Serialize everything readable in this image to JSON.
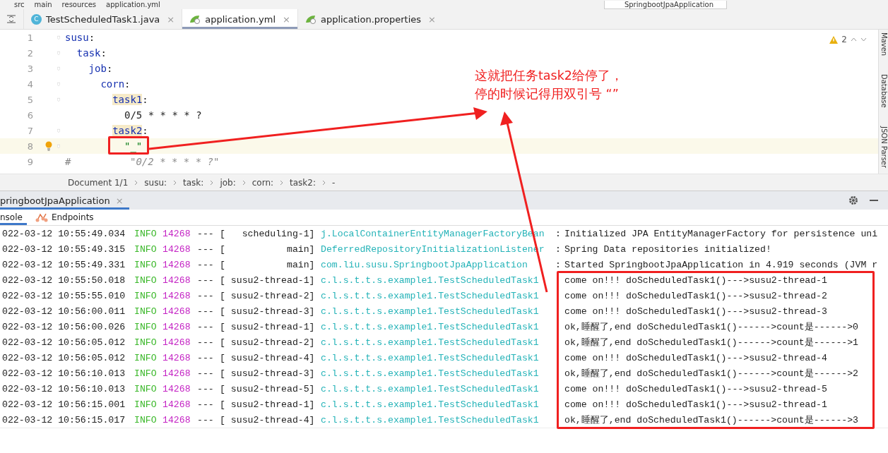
{
  "path_bar": {
    "items": [
      "src",
      "main",
      "resources",
      "application.yml"
    ],
    "run_config": "SpringbootJpaApplication"
  },
  "tabs": [
    {
      "label": "TestScheduledTask1.java",
      "kind": "class",
      "icon": "C",
      "close": "×",
      "selected": false
    },
    {
      "label": "application.yml",
      "kind": "spring",
      "close": "×",
      "selected": true
    },
    {
      "label": "application.properties",
      "kind": "spring",
      "close": "×",
      "selected": false
    }
  ],
  "editor": {
    "warnings": "2",
    "lines": [
      {
        "number": "1",
        "key": "susu",
        "colon": ":",
        "children": [
          {
            "number": "2",
            "key": "task",
            "colon": ":",
            "children": [
              {
                "number": "3",
                "key": "job",
                "colon": ":",
                "children": [
                  {
                    "number": "4",
                    "key": "corn",
                    "colon": ":",
                    "children": [
                      {
                        "number": "5",
                        "key": "task1",
                        "colon": ":",
                        "highlighted": true,
                        "children": [
                          {
                            "number": "6",
                            "value": "0/5 * * * * ?",
                            "kind": "plain"
                          }
                        ]
                      },
                      {
                        "number": "7",
                        "key": "task2",
                        "colon": ":",
                        "highlighted": true,
                        "children": [
                          {
                            "number": "8",
                            "value": "\"_\"",
                            "kind": "string",
                            "current": true
                          },
                          {
                            "number": "9",
                            "value": "\"0/2 * * * * ?\"",
                            "kind": "comment",
                            "comment": "#"
                          }
                        ]
                      }
                    ]
                  }
                ]
              }
            ]
          }
        ]
      }
    ]
  },
  "breadcrumb": [
    "Document 1/1",
    "susu:",
    "task:",
    "job:",
    "corn:",
    "task2:",
    "-"
  ],
  "run_panel": {
    "tab": "pringbootJpaApplication",
    "close": "×",
    "subtabs": [
      {
        "label": "nsole",
        "selected": true,
        "kind": "console"
      },
      {
        "label": "Endpoints",
        "selected": false,
        "kind": "endpoints"
      }
    ]
  },
  "log": [
    {
      "time": "022-03-12 10:55:49.034",
      "level": "INFO",
      "pid": "14268",
      "dashes": "---",
      "thread": "[   scheduling-1]",
      "logger": "j.LocalContainerEntityManagerFactoryBean",
      "sep": ":",
      "message": "Initialized JPA EntityManagerFactory for persistence uni"
    },
    {
      "time": "022-03-12 10:55:49.315",
      "level": "INFO",
      "pid": "14268",
      "dashes": "---",
      "thread": "[           main]",
      "logger": "DeferredRepositoryInitializationListener",
      "sep": ":",
      "message": "Spring Data repositories initialized!"
    },
    {
      "time": "022-03-12 10:55:49.331",
      "level": "INFO",
      "pid": "14268",
      "dashes": "---",
      "thread": "[           main]",
      "logger": "com.liu.susu.SpringbootJpaApplication",
      "sep": ":",
      "message": "Started SpringbootJpaApplication in 4.919 seconds (JVM r"
    },
    {
      "time": "022-03-12 10:55:50.018",
      "level": "INFO",
      "pid": "14268",
      "dashes": "---",
      "thread": "[ susu2-thread-1]",
      "logger": "c.l.s.t.t.s.example1.TestScheduledTask1",
      "message": "come on!!! doScheduledTask1()--->susu2-thread-1"
    },
    {
      "time": "022-03-12 10:55:55.010",
      "level": "INFO",
      "pid": "14268",
      "dashes": "---",
      "thread": "[ susu2-thread-2]",
      "logger": "c.l.s.t.t.s.example1.TestScheduledTask1",
      "message": "come on!!! doScheduledTask1()--->susu2-thread-2"
    },
    {
      "time": "022-03-12 10:56:00.011",
      "level": "INFO",
      "pid": "14268",
      "dashes": "---",
      "thread": "[ susu2-thread-3]",
      "logger": "c.l.s.t.t.s.example1.TestScheduledTask1",
      "message": "come on!!! doScheduledTask1()--->susu2-thread-3"
    },
    {
      "time": "022-03-12 10:56:00.026",
      "level": "INFO",
      "pid": "14268",
      "dashes": "---",
      "thread": "[ susu2-thread-1]",
      "logger": "c.l.s.t.t.s.example1.TestScheduledTask1",
      "message": "ok,睡醒了,end doScheduledTask1()------>count是------>0"
    },
    {
      "time": "022-03-12 10:56:05.012",
      "level": "INFO",
      "pid": "14268",
      "dashes": "---",
      "thread": "[ susu2-thread-2]",
      "logger": "c.l.s.t.t.s.example1.TestScheduledTask1",
      "message": "ok,睡醒了,end doScheduledTask1()------>count是------>1"
    },
    {
      "time": "022-03-12 10:56:05.012",
      "level": "INFO",
      "pid": "14268",
      "dashes": "---",
      "thread": "[ susu2-thread-4]",
      "logger": "c.l.s.t.t.s.example1.TestScheduledTask1",
      "message": "come on!!! doScheduledTask1()--->susu2-thread-4"
    },
    {
      "time": "022-03-12 10:56:10.013",
      "level": "INFO",
      "pid": "14268",
      "dashes": "---",
      "thread": "[ susu2-thread-3]",
      "logger": "c.l.s.t.t.s.example1.TestScheduledTask1",
      "message": "ok,睡醒了,end doScheduledTask1()------>count是------>2"
    },
    {
      "time": "022-03-12 10:56:10.013",
      "level": "INFO",
      "pid": "14268",
      "dashes": "---",
      "thread": "[ susu2-thread-5]",
      "logger": "c.l.s.t.t.s.example1.TestScheduledTask1",
      "message": "come on!!! doScheduledTask1()--->susu2-thread-5"
    },
    {
      "time": "022-03-12 10:56:15.001",
      "level": "INFO",
      "pid": "14268",
      "dashes": "---",
      "thread": "[ susu2-thread-1]",
      "logger": "c.l.s.t.t.s.example1.TestScheduledTask1",
      "message": "come on!!! doScheduledTask1()--->susu2-thread-1"
    },
    {
      "time": "022-03-12 10:56:15.017",
      "level": "INFO",
      "pid": "14268",
      "dashes": "---",
      "thread": "[ susu2-thread-4]",
      "logger": "c.l.s.t.t.s.example1.TestScheduledTask1",
      "message": "ok,睡醒了,end doScheduledTask1()------>count是------>3"
    }
  ],
  "side_tools": [
    "Maven",
    "Database",
    "JSON Parser"
  ],
  "annotation": {
    "lines": [
      "这就把任务task2给停了，",
      "停的时候记得用双引号 “”"
    ]
  }
}
